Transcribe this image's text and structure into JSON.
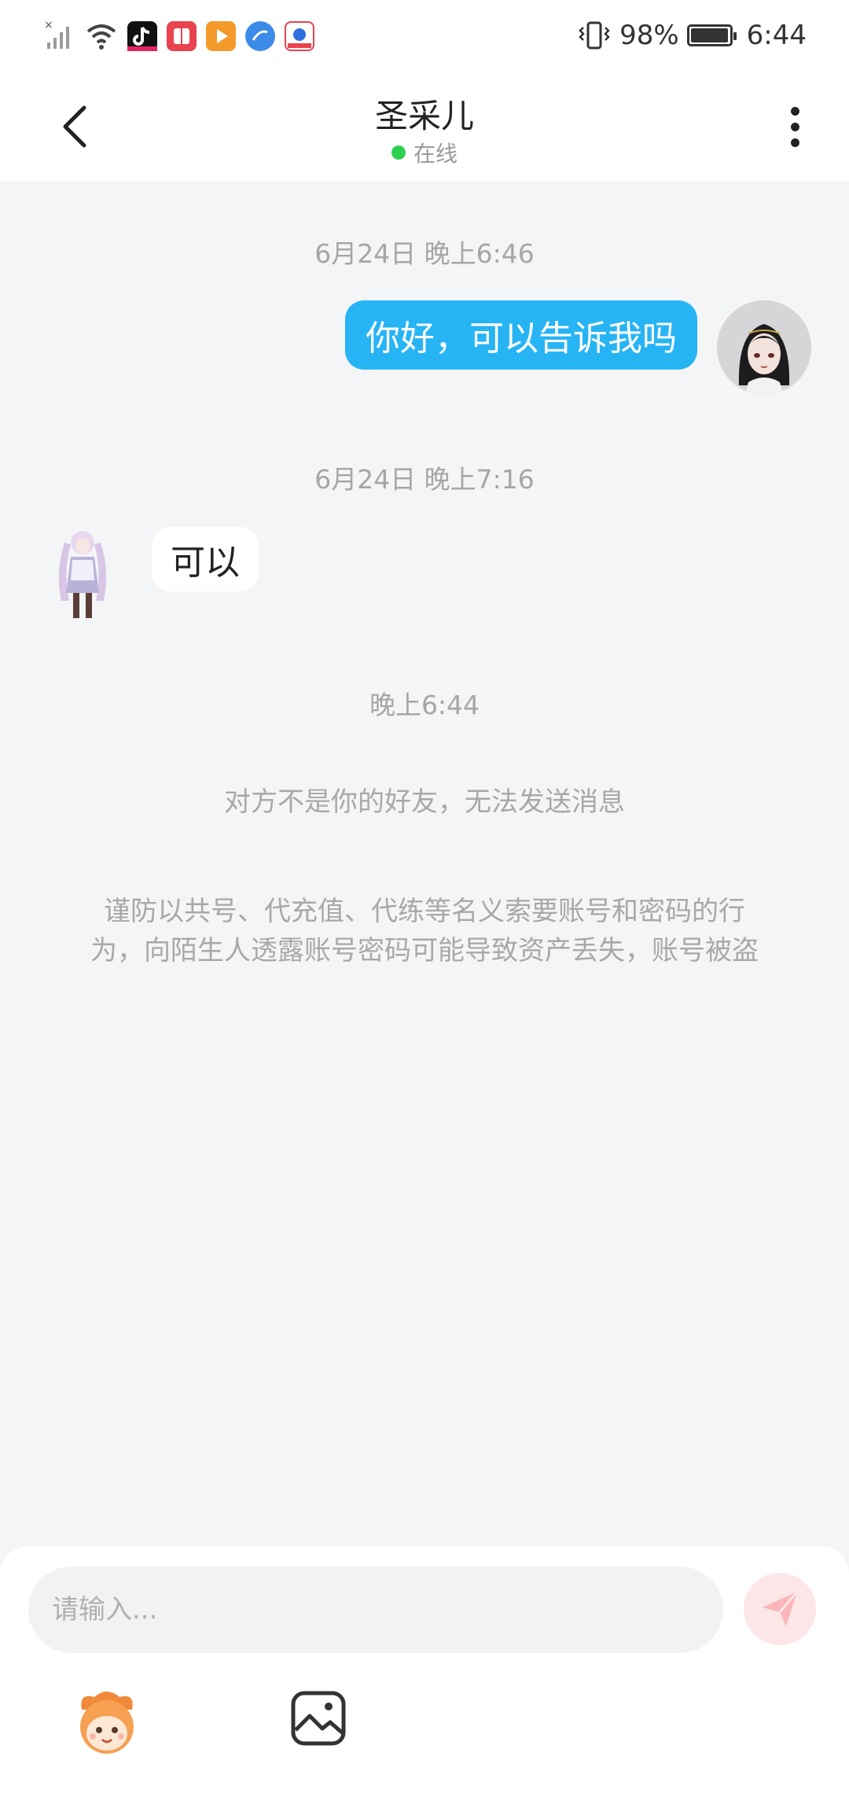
{
  "status_bar": {
    "battery": "98%",
    "time": "6:44",
    "icons": [
      "no-signal-icon",
      "wifi-icon",
      "tiktok-icon",
      "book-app-icon",
      "video-app-icon",
      "browser-icon",
      "baidu-icon",
      "vibrate-icon",
      "battery-icon"
    ]
  },
  "header": {
    "title": "圣采儿",
    "status": "在线",
    "status_color": "#2fcf4f",
    "back_icon": "chevron-left-icon",
    "more_icon": "more-vertical-icon"
  },
  "chat": {
    "timestamp_1": "6月24日 晚上6:46",
    "message_out": "你好，可以告诉我吗",
    "timestamp_2": "6月24日 晚上7:16",
    "message_in": "可以",
    "timestamp_3": "晚上6:44",
    "not_friend_notice": "对方不是你的好友，无法发送消息",
    "warning_line1": "谨防以共号、代充值、代练等名义索要账号和密码的行",
    "warning_line2": "为，向陌生人透露账号密码可能导致资产丢失，账号被盗",
    "bubble_out_color": "#27b4f5"
  },
  "composer": {
    "placeholder": "请输入...",
    "value": "",
    "send_icon": "send-icon",
    "tools": [
      "emoji-mascot-icon",
      "image-icon"
    ]
  }
}
